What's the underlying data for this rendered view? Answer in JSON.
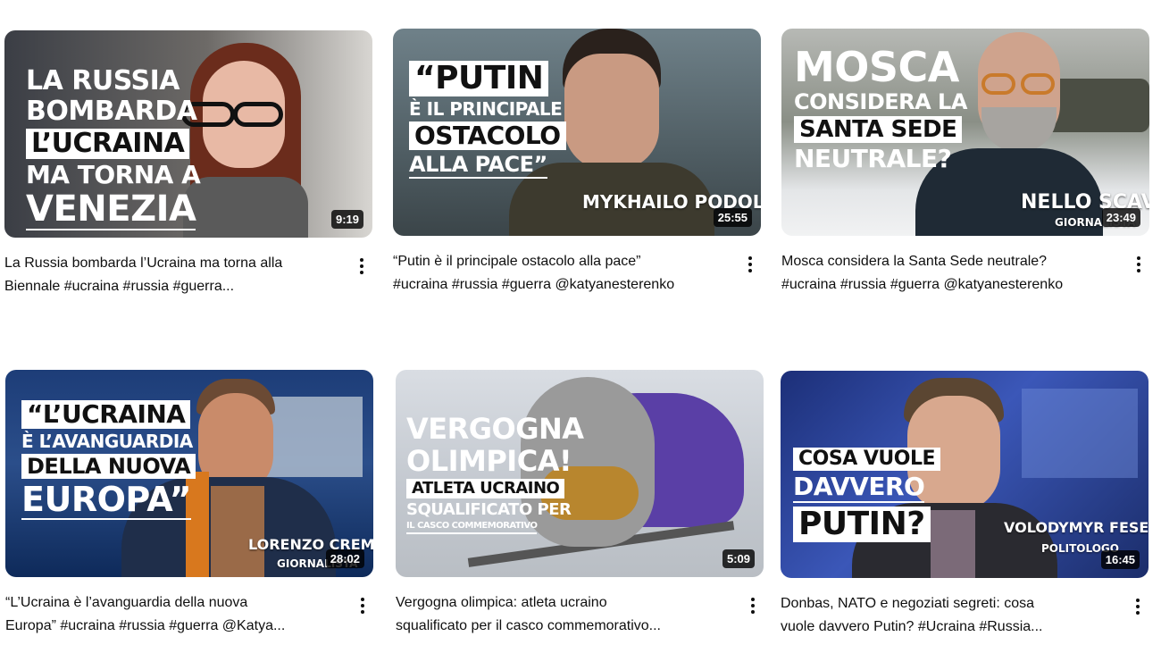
{
  "videos": [
    {
      "title_line1": "La Russia bombarda l’Ucraina ma torna alla",
      "title_line2": "Biennale #ucraina #russia #guerra...",
      "duration": "9:19",
      "overlay": [
        "La Russia",
        "bombarda",
        "l’Ucraina",
        "ma torna a",
        "Venezia"
      ]
    },
    {
      "title_line1": "“Putin è il principale ostacolo alla pace”",
      "title_line2": "#ucraina #russia #guerra @katyanesterenko",
      "duration": "25:55",
      "overlay": [
        "“Putin",
        "è il principale",
        "ostacolo",
        "alla pace”"
      ],
      "caption_name": "Mykhailo Podolyak"
    },
    {
      "title_line1": "Mosca considera la Santa Sede neutrale?",
      "title_line2": "#ucraina #russia #guerra @katyanesterenko",
      "duration": "23:49",
      "overlay": [
        "Mosca",
        "considera la",
        "Santa Sede",
        "neutrale?"
      ],
      "caption_name": "Nello Scavo",
      "caption_role": "Giornalista"
    },
    {
      "title_line1": "“L’Ucraina è l’avanguardia della nuova",
      "title_line2": "Europa” #ucraina #russia #guerra @Katya...",
      "duration": "28:02",
      "overlay": [
        "“L’Ucraina",
        "è l’avanguardia",
        "della nuova",
        "Europa”"
      ],
      "caption_name": "Lorenzo Cremonesi",
      "caption_role": "Giornalista"
    },
    {
      "title_line1": "Vergogna olimpica: atleta ucraino",
      "title_line2": "squalificato per il casco commemorativo...",
      "duration": "5:09",
      "overlay": [
        "Vergogna",
        "olimpica!",
        "Atleta ucraino",
        "squalificato per",
        "il casco commemorativo"
      ]
    },
    {
      "title_line1": "Donbas, NATO e negoziati segreti: cosa",
      "title_line2": "vuole davvero Putin? #Ucraina #Russia...",
      "duration": "16:45",
      "overlay": [
        "Cosa vuole",
        "davvero",
        "Putin?"
      ],
      "caption_name": "Volodymyr Fesenko",
      "caption_role": "Politologo"
    }
  ],
  "icons": {
    "more": "more-vert-icon"
  }
}
